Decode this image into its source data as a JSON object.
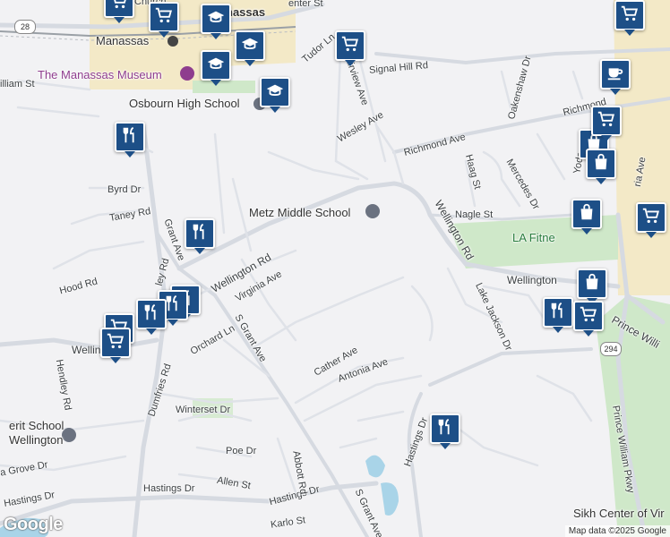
{
  "roads": {
    "wellington_rd_w": "Wellington Rd",
    "wellington_rd_ne": "Wellington Rd",
    "wellington_e": "Wellington",
    "wellington_w": "Wellin",
    "grant_ave": "Grant Ave",
    "s_grant_ave": "S Grant Ave",
    "s_grant_ave_s": "S Grant Ave",
    "dumfries_rd": "Dumfries Rd",
    "hastings_dr_1": "Hastings Dr",
    "hastings_dr_2": "Hastings Dr",
    "hastings_dr_3": "Hastings Dr",
    "hastings_dr_4": "Hastings Dr",
    "virginia_ave": "Virginia Ave",
    "orchard_ln": "Orchard Ln",
    "cather_ave": "Cather Ave",
    "antonia_ave": "Antonia Ave",
    "winterset_dr": "Winterset Dr",
    "poe_dr": "Poe Dr",
    "allen_st": "Allen St",
    "abbott_rd": "Abbott Rd",
    "karlo_st": "Karlo St",
    "hendley_rd": "Hendley Rd",
    "hood_rd": "Hood Rd",
    "byrd_dr": "Byrd Dr",
    "taney_rd": "Taney Rd",
    "ley_rd": "ley Rd",
    "nagle_st": "Nagle St",
    "lake_jackson_dr": "Lake Jackson Dr",
    "richmond_ave": "Richmond Ave",
    "richmond_ne": "Richmond",
    "wesley_ave": "Wesley Ave",
    "fairview_ave": "Fairview Ave",
    "tudor_ln": "Tudor Ln",
    "signal_hill_rd": "Signal Hill Rd",
    "oakenshaw_dr": "Oakenshaw Dr",
    "haag_st": "Haag St",
    "mercedes_dr": "Mercedes Dr",
    "prince_william_pkwy": "Prince William Pkwy",
    "prince_willi": "Prince Willi",
    "william_st": "illiam St",
    "grove_dr": "a Grove Dr",
    "center_st": "enter St",
    "church_st": "Church",
    "yode": "Yode",
    "ria_ave": "ria Ave",
    "route_28": "28",
    "route_294": "294"
  },
  "places": {
    "manassas": "Manassas",
    "manassas_top": "nassas",
    "museum": "The Manassas Museum",
    "osbourn": "Osbourn High School",
    "metz": "Metz Middle School",
    "la_fitness": "LA Fitne",
    "merit_1": "erit School",
    "merit_2": "Wellington",
    "sikh": "Sikh Center of Vir"
  },
  "markers": [
    {
      "icon": "shopping-cart-icon"
    },
    {
      "icon": "shopping-cart-icon"
    },
    {
      "icon": "school-icon"
    },
    {
      "icon": "school-icon"
    },
    {
      "icon": "school-icon"
    },
    {
      "icon": "school-icon"
    },
    {
      "icon": "shopping-cart-icon"
    },
    {
      "icon": "shopping-cart-icon"
    },
    {
      "icon": "coffee-icon"
    },
    {
      "icon": "restaurant-icon"
    },
    {
      "icon": "restaurant-icon"
    },
    {
      "icon": "restaurant-icon"
    },
    {
      "icon": "restaurant-icon"
    },
    {
      "icon": "restaurant-icon"
    },
    {
      "icon": "shopping-cart-icon"
    },
    {
      "icon": "shopping-cart-icon"
    },
    {
      "icon": "shopping-bag-icon"
    },
    {
      "icon": "shopping-bag-icon"
    },
    {
      "icon": "shopping-cart-icon"
    },
    {
      "icon": "shopping-cart-icon"
    },
    {
      "icon": "shopping-bag-icon"
    },
    {
      "icon": "shopping-bag-icon"
    },
    {
      "icon": "restaurant-icon"
    },
    {
      "icon": "shopping-cart-icon"
    },
    {
      "icon": "restaurant-icon"
    }
  ],
  "branding": {
    "google": "Google",
    "attribution": "Map data ©2025 Google"
  },
  "colors": {
    "marker": "#1d4f87",
    "background": "#f2f2f4",
    "road": "#d9dde4",
    "green": "#cfe8c9",
    "water": "#a9d4e8",
    "downtown": "#f3e8c2"
  }
}
